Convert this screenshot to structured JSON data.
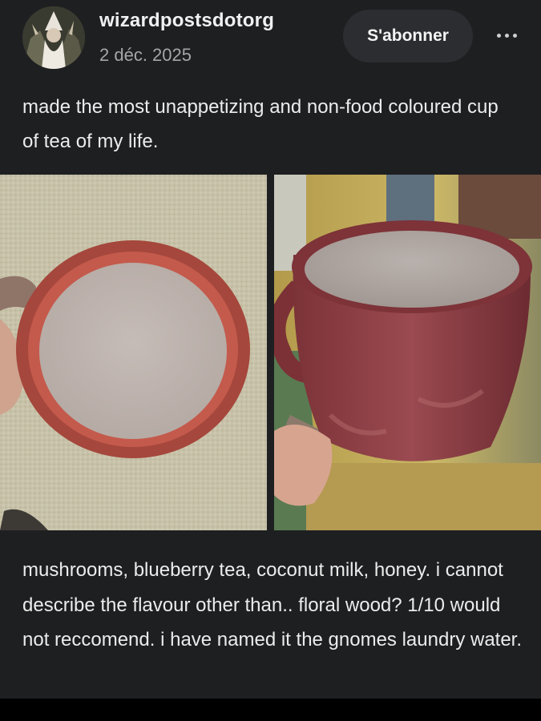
{
  "post": {
    "author": {
      "username": "wizardpostsdotorg",
      "date": "2 déc. 2025",
      "avatar_icon": "wizard-avatar"
    },
    "actions": {
      "follow_label": "S'abonner",
      "more_icon": "ellipsis-icon"
    },
    "caption": "made the most unappetizing and non-food coloured cup of tea of my life.",
    "photos": [
      {
        "name": "tea-cup-top-view"
      },
      {
        "name": "tea-cup-side-view"
      }
    ],
    "body": "mushrooms, blueberry tea, coconut milk, honey. i cannot describe the flavour other than.. floral wood? 1/10 would not reccomend. i have named it the gnomes laundry water."
  },
  "colors": {
    "background": "#1e1f21",
    "button": "#2c2d30",
    "text": "#ececec",
    "muted": "#a6a6a6"
  }
}
